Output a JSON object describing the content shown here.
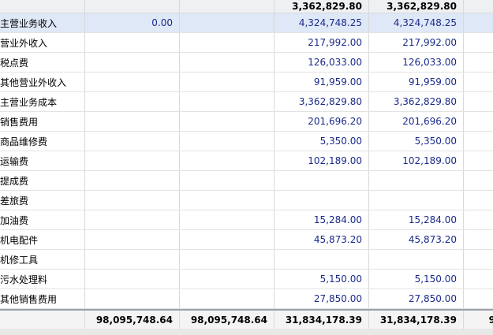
{
  "header": {
    "col3": "3,362,829.80",
    "col4": "3,362,829.80"
  },
  "rows": [
    {
      "name": "主营业务收入",
      "c1": "0.00",
      "c2": "",
      "c3": "4,324,748.25",
      "c4": "4,324,748.25",
      "selected": true
    },
    {
      "name": "营业外收入",
      "c1": "",
      "c2": "",
      "c3": "217,992.00",
      "c4": "217,992.00"
    },
    {
      "name": "税点费",
      "c1": "",
      "c2": "",
      "c3": "126,033.00",
      "c4": "126,033.00"
    },
    {
      "name": "其他营业外收入",
      "c1": "",
      "c2": "",
      "c3": "91,959.00",
      "c4": "91,959.00"
    },
    {
      "name": "主营业务成本",
      "c1": "",
      "c2": "",
      "c3": "3,362,829.80",
      "c4": "3,362,829.80"
    },
    {
      "name": "销售费用",
      "c1": "",
      "c2": "",
      "c3": "201,696.20",
      "c4": "201,696.20"
    },
    {
      "name": "商品维修费",
      "c1": "",
      "c2": "",
      "c3": "5,350.00",
      "c4": "5,350.00"
    },
    {
      "name": "运输费",
      "c1": "",
      "c2": "",
      "c3": "102,189.00",
      "c4": "102,189.00"
    },
    {
      "name": "提成费",
      "c1": "",
      "c2": "",
      "c3": "",
      "c4": ""
    },
    {
      "name": "差旅费",
      "c1": "",
      "c2": "",
      "c3": "",
      "c4": ""
    },
    {
      "name": "加油费",
      "c1": "",
      "c2": "",
      "c3": "15,284.00",
      "c4": "15,284.00"
    },
    {
      "name": "机电配件",
      "c1": "",
      "c2": "",
      "c3": "45,873.20",
      "c4": "45,873.20"
    },
    {
      "name": "机修工具",
      "c1": "",
      "c2": "",
      "c3": "",
      "c4": ""
    },
    {
      "name": "污水处理料",
      "c1": "",
      "c2": "",
      "c3": "5,150.00",
      "c4": "5,150.00"
    },
    {
      "name": "其他销售费用",
      "c1": "",
      "c2": "",
      "c3": "27,850.00",
      "c4": "27,850.00"
    }
  ],
  "totals": {
    "c1": "98,095,748.64",
    "c2": "98,095,748.64",
    "c3": "31,834,178.39",
    "c4": "31,834,178.39",
    "c5": "9"
  }
}
